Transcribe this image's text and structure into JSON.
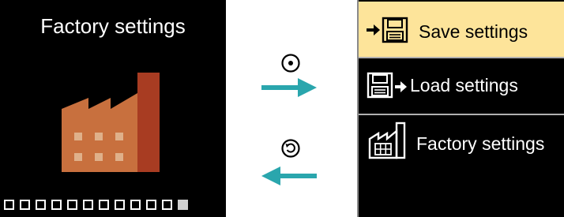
{
  "left_screen": {
    "title": "Factory settings",
    "icon": "factory-icon",
    "page_indicator": {
      "total": 12,
      "current": 12
    }
  },
  "navigation": {
    "select_icon": "select-circle-icon",
    "back_icon": "back-circle-icon",
    "forward_icon": "arrow-right-icon",
    "backward_icon": "arrow-left-icon"
  },
  "menu": {
    "items": [
      {
        "label": "Save settings",
        "icon": "save-settings-icon",
        "selected": true
      },
      {
        "label": "Load settings",
        "icon": "load-settings-icon",
        "selected": false
      },
      {
        "label": "Factory settings",
        "icon": "factory-icon",
        "selected": false
      }
    ]
  },
  "colors": {
    "screen_bg": "#000000",
    "selected_bg": "#fde49a",
    "factory_orange": "#c8703e",
    "chimney_red": "#a83c22",
    "arrow_teal": "#2aa6ad"
  }
}
